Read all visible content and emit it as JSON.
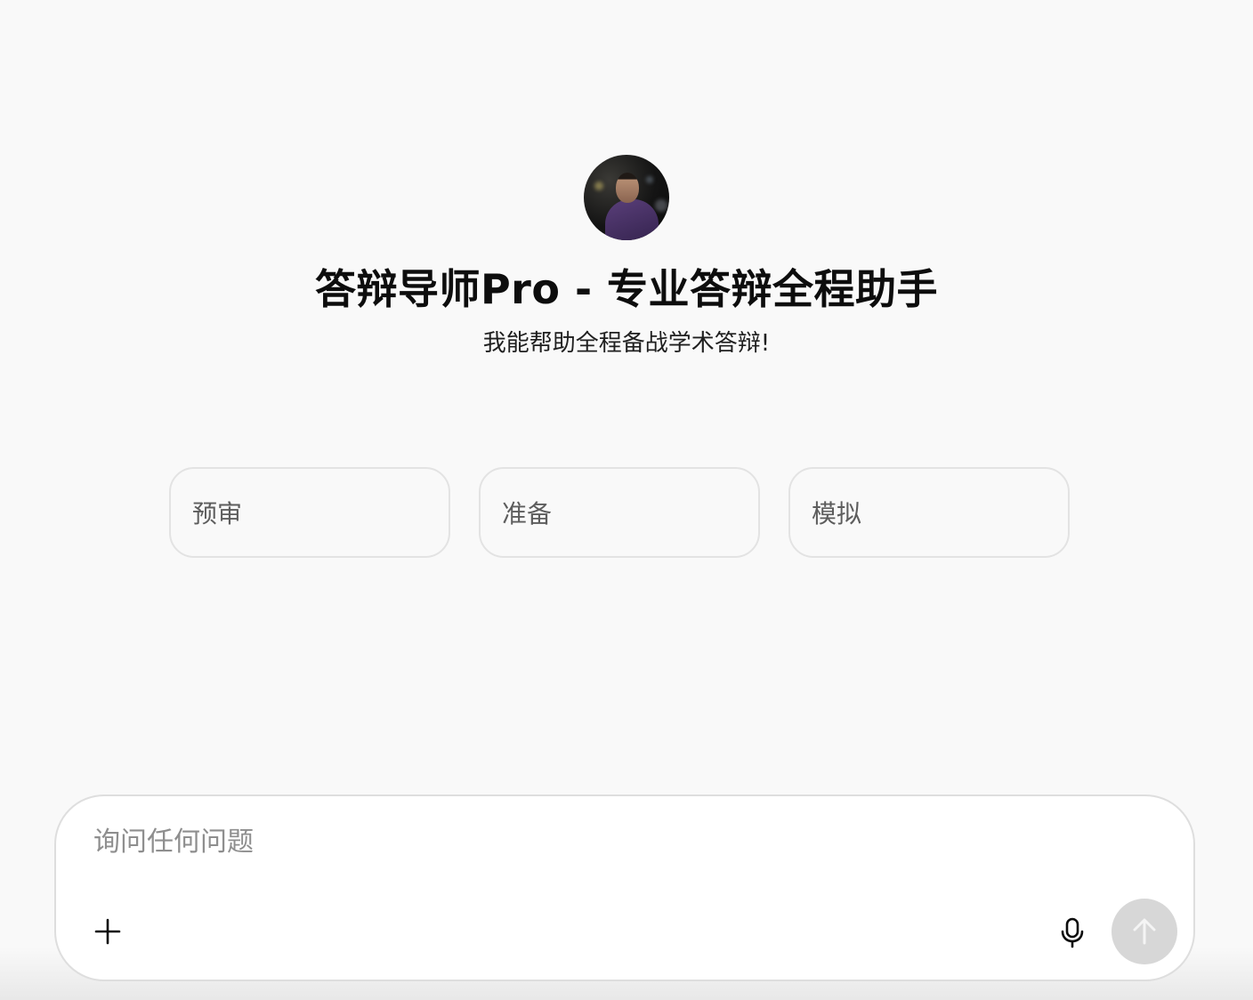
{
  "gpt": {
    "title": "答辩导师Pro - 专业答辩全程助手",
    "description": "我能帮助全程备战学术答辩!"
  },
  "starters": [
    {
      "label": "预审"
    },
    {
      "label": "准备"
    },
    {
      "label": "模拟"
    }
  ],
  "composer": {
    "placeholder": "询问任何问题"
  },
  "icons": {
    "attach": "plus-icon",
    "voice": "microphone-icon",
    "send": "arrow-up-icon"
  },
  "colors": {
    "background": "#f9f9f9",
    "send_disabled": "#d7d7d7"
  }
}
